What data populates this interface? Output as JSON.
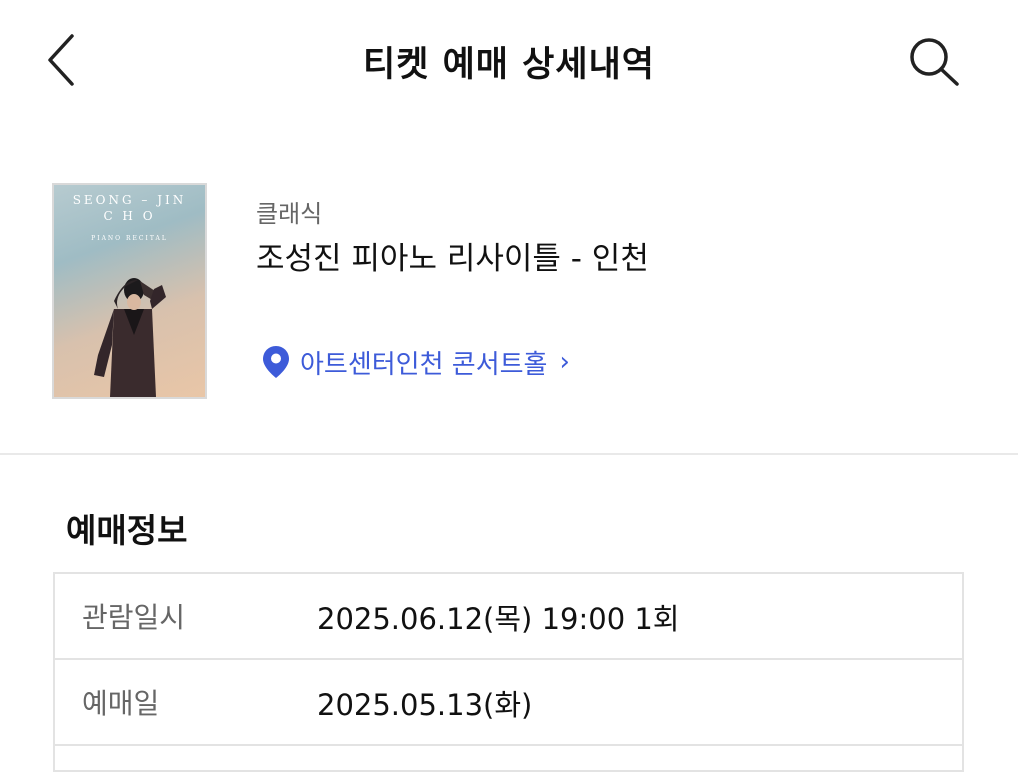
{
  "header": {
    "title": "티켓 예매 상세내역",
    "back_icon": "chevron-left-icon",
    "search_icon": "search-icon"
  },
  "event": {
    "category": "클래식",
    "title": "조성진 피아노 리사이틀 - 인천",
    "poster": {
      "line1": "SEONG – JIN",
      "line2": "C H O",
      "line3": "PIANO RECITAL"
    },
    "venue": {
      "name": "아트센터인천 콘서트홀",
      "chevron": "›",
      "icon": "location-pin-icon",
      "color": "#3d5bd9"
    }
  },
  "booking_info": {
    "section_title": "예매정보",
    "rows": [
      {
        "label": "관람일시",
        "value": "2025.06.12(목) 19:00 1회"
      },
      {
        "label": "예매일",
        "value": "2025.05.13(화)"
      }
    ]
  },
  "colors": {
    "accent": "#3d5bd9",
    "text": "#111111",
    "muted": "#666666",
    "border": "#e3e3e3"
  }
}
